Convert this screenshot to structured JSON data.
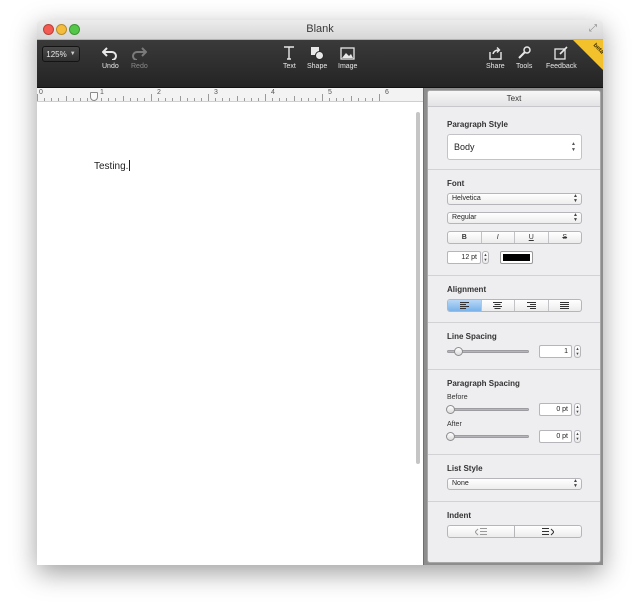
{
  "window": {
    "title": "Blank"
  },
  "toolbar": {
    "zoom": "125%",
    "undo_label": "Undo",
    "redo_label": "Redo",
    "text_label": "Text",
    "shape_label": "Shape",
    "image_label": "Image",
    "share_label": "Share",
    "tools_label": "Tools",
    "feedback_label": "Feedback",
    "beta_badge": "beta"
  },
  "ruler": {
    "numbers": [
      "0",
      "1",
      "2",
      "3",
      "4",
      "5",
      "6"
    ]
  },
  "document": {
    "body_text": "Testing."
  },
  "inspector": {
    "title": "Text",
    "paragraph_style": {
      "label": "Paragraph Style",
      "value": "Body"
    },
    "font": {
      "label": "Font",
      "family": "Helvetica",
      "typeface": "Regular",
      "bold": "B",
      "italic": "I",
      "underline": "U",
      "strikethrough": "S",
      "size": "12 pt",
      "color": "#000000"
    },
    "alignment": {
      "label": "Alignment",
      "options": [
        "left",
        "center",
        "right",
        "justify"
      ],
      "selected": "left"
    },
    "line_spacing": {
      "label": "Line Spacing",
      "value": "1"
    },
    "paragraph_spacing": {
      "label": "Paragraph Spacing",
      "before_label": "Before",
      "before_value": "0 pt",
      "after_label": "After",
      "after_value": "0 pt"
    },
    "list_style": {
      "label": "List Style",
      "value": "None"
    },
    "indent": {
      "label": "Indent"
    }
  }
}
